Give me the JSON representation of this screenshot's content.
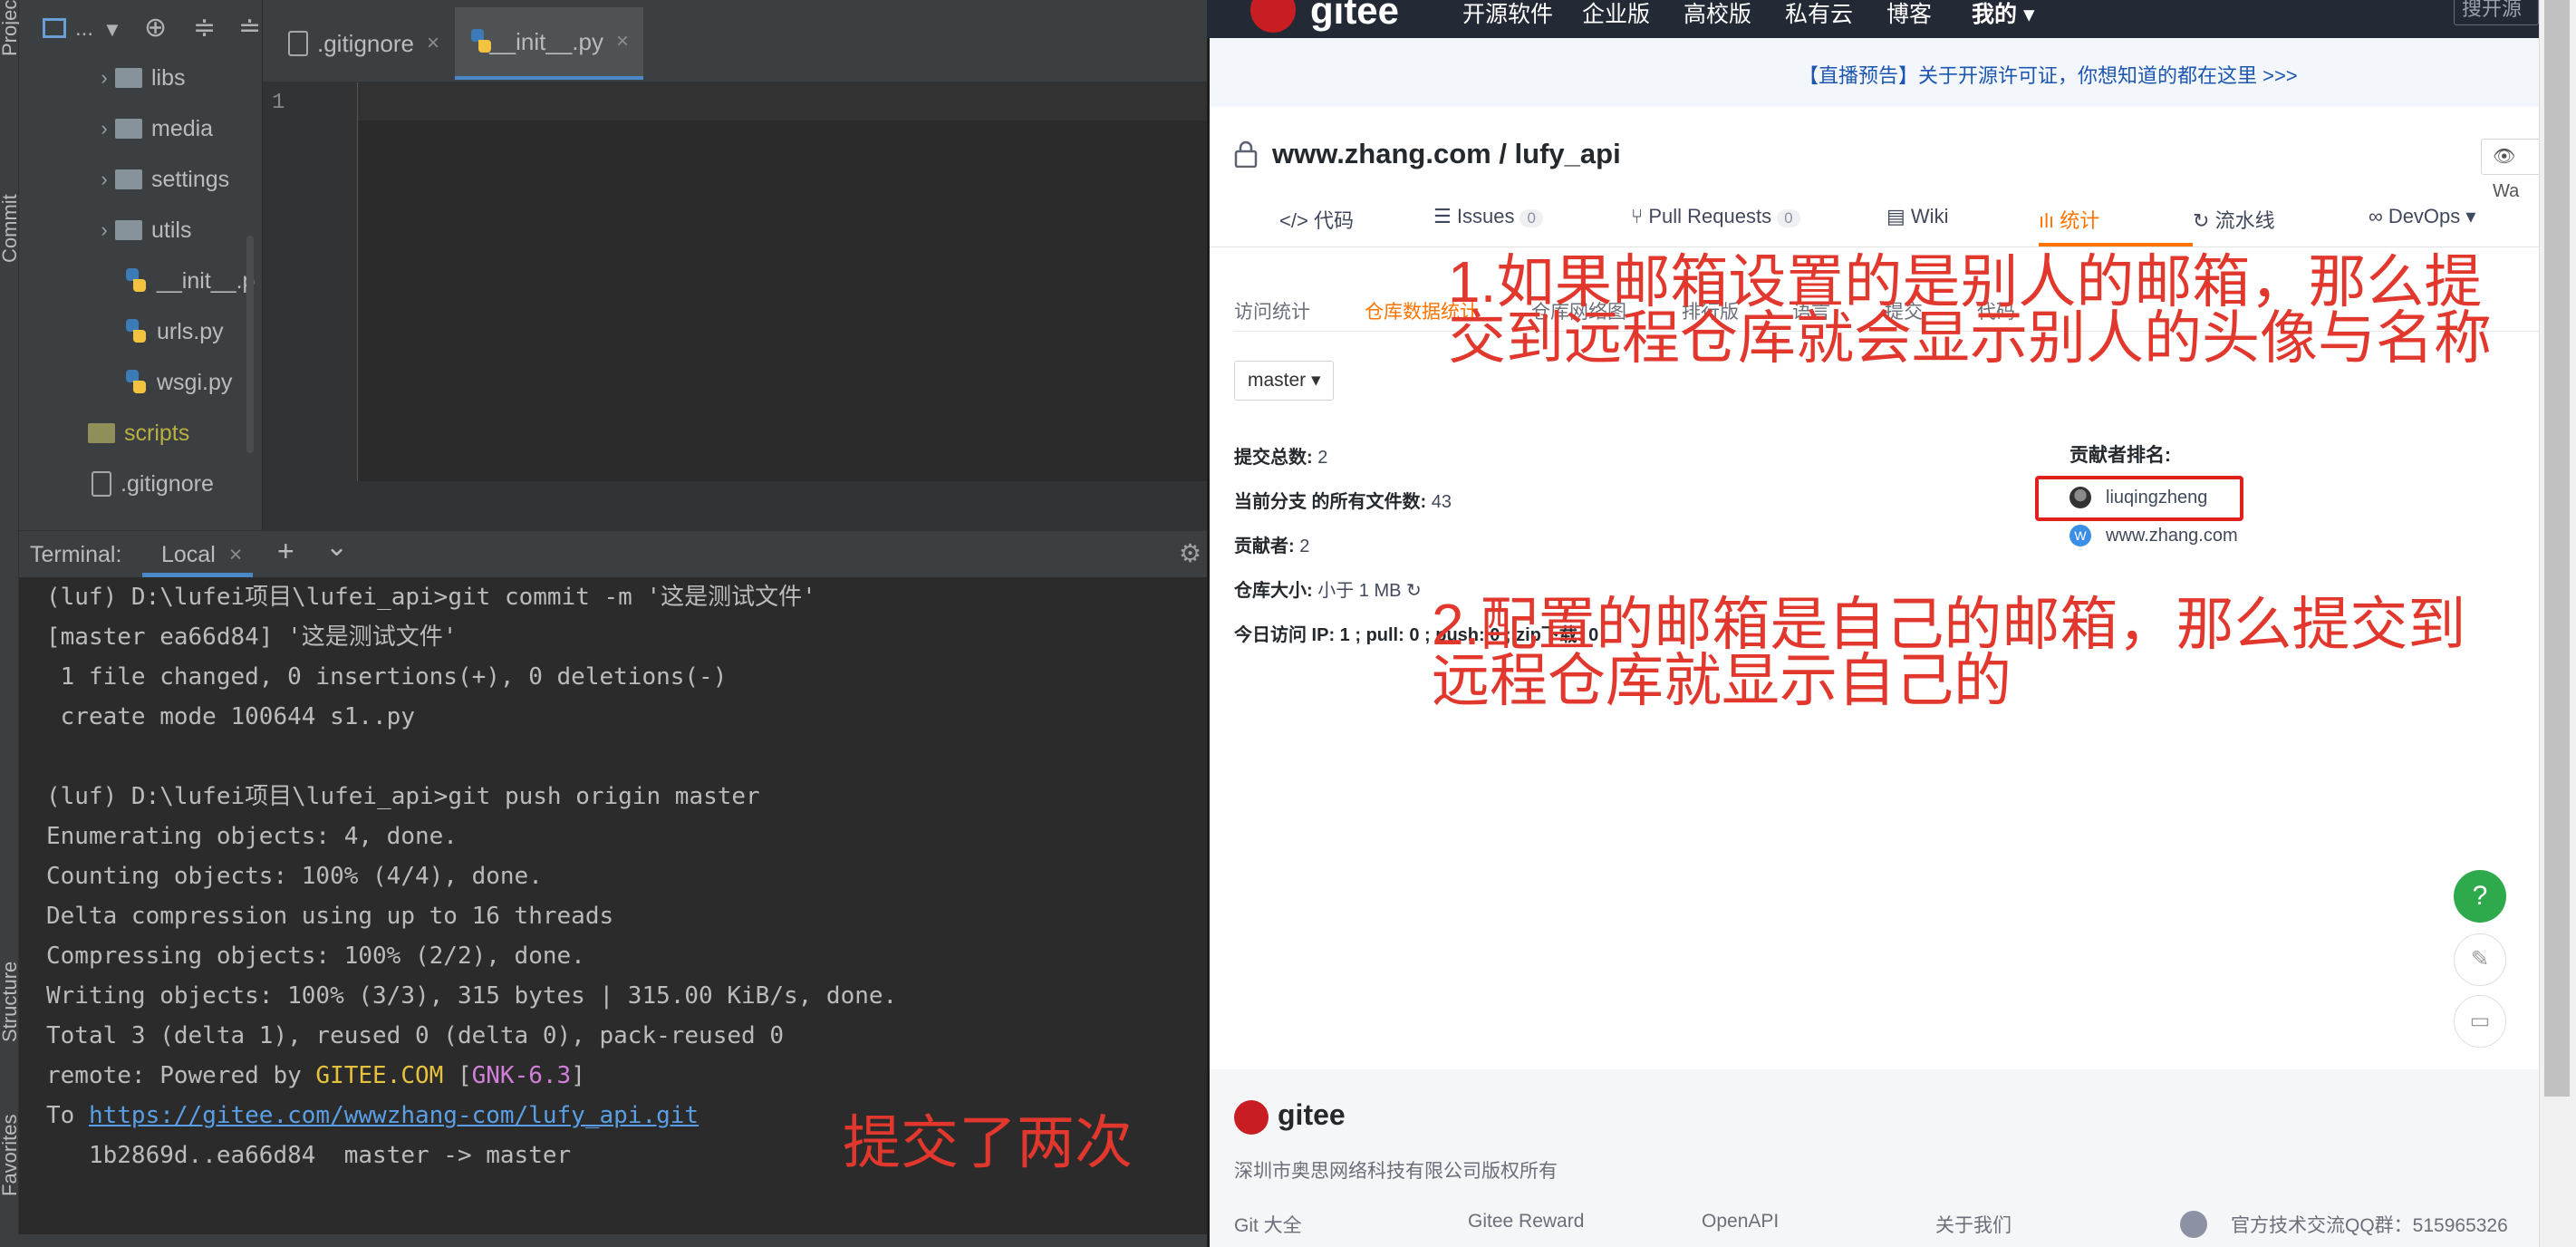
{
  "ide": {
    "side_tabs": {
      "project": "Project",
      "commit": "Commit",
      "structure": "Structure",
      "favorites": "Favorites"
    },
    "project_toolbar": {
      "dropdown": "..."
    },
    "tree": [
      {
        "label": "libs",
        "kind": "folder"
      },
      {
        "label": "media",
        "kind": "folder"
      },
      {
        "label": "settings",
        "kind": "folder"
      },
      {
        "label": "utils",
        "kind": "folder"
      },
      {
        "label": "__init__.p",
        "kind": "python-file"
      },
      {
        "label": "urls.py",
        "kind": "python-file"
      },
      {
        "label": "wsgi.py",
        "kind": "python-file"
      },
      {
        "label": "scripts",
        "kind": "folder"
      },
      {
        "label": ".gitignore",
        "kind": "git-file"
      }
    ],
    "editor_tabs": [
      {
        "label": ".gitignore",
        "close": "×"
      },
      {
        "label": "__init__.py",
        "close": "×"
      }
    ],
    "line_number": "1",
    "terminal": {
      "label": "Terminal:",
      "tab": "Local",
      "tab_close": "×",
      "add": "+",
      "menu": "⌄",
      "lines": [
        "(luf) D:\\lufei项目\\lufei_api>git commit -m '这是测试文件'",
        "[master ea66d84] '这是测试文件'",
        " 1 file changed, 0 insertions(+), 0 deletions(-)",
        " create mode 100644 s1..py",
        "",
        "(luf) D:\\lufei项目\\lufei_api>git push origin master",
        "Enumerating objects: 4, done.",
        "Counting objects: 100% (4/4), done.",
        "Delta compression using up to 16 threads",
        "Compressing objects: 100% (2/2), done.",
        "Writing objects: 100% (3/3), 315 bytes | 315.00 KiB/s, done.",
        "Total 3 (delta 1), reused 0 (delta 0), pack-reused 0"
      ],
      "remote_line": {
        "prefix": "remote: Powered by ",
        "gitee": "GITEE.COM",
        "open": " [",
        "gnk": "GNK-6.3",
        "close": "]"
      },
      "to_line": {
        "prefix": "To ",
        "url": "https://gitee.com/wwwzhang-com/lufy_api.git"
      },
      "last_line": "   1b2869d..ea66d84  master -> master"
    },
    "annotation": "提交了两次"
  },
  "browser": {
    "topnav": {
      "logo": "gitee",
      "items": [
        "开源软件",
        "企业版",
        "高校版",
        "私有云",
        "博客",
        "我的 ▾"
      ],
      "search": "搜开源"
    },
    "announcement": "【直播预告】关于开源许可证，你想知道的都在这里 >>>",
    "repo_title": "www.zhang.com / lufy_api",
    "watch": "Wa",
    "tabs": [
      {
        "label": "代码",
        "icon": "</>"
      },
      {
        "label": "Issues",
        "icon": "☰",
        "count": "0"
      },
      {
        "label": "Pull Requests",
        "icon": "⑂",
        "count": "0"
      },
      {
        "label": "Wiki",
        "icon": "▤"
      },
      {
        "label": "统计",
        "icon": "ılı"
      },
      {
        "label": "流水线",
        "icon": "↻"
      },
      {
        "label": "DevOps ▾",
        "icon": "∞"
      }
    ],
    "subtabs": [
      "访问统计",
      "仓库数据统计",
      "仓库网络图",
      "排行版",
      "语言",
      "提交",
      "代码"
    ],
    "branch": "master ▾",
    "stats": [
      {
        "label": "提交总数:",
        "value": " 2"
      },
      {
        "label": "当前分支 的所有文件数:",
        "value": " 43"
      },
      {
        "label": "贡献者:",
        "value": " 2"
      },
      {
        "label": "仓库大小:",
        "value": " 小于 1 MB ↻"
      },
      {
        "label": "今日访问 IP: 1 ; pull: 0 ; push: 0 ; zip下载: 0",
        "value": ""
      }
    ],
    "contributors_title": "贡献者排名:",
    "contributors": [
      {
        "name": "liuqingzheng",
        "avatar": "photo-avatar"
      },
      {
        "name": "www.zhang.com",
        "avatar": "W"
      }
    ],
    "annotation_1": "1.如果邮箱设置的是别人的邮箱，那么提交到远程仓库就会显示别人的头像与名称",
    "annotation_2": "2.配置的邮箱是自己的邮箱，那么提交到远程仓库就显示自己的",
    "float_buttons": {
      "help": "?",
      "edit": "✎",
      "chat": "▭"
    },
    "footer": {
      "logo": "gitee",
      "copyright": "深圳市奥思网络科技有限公司版权所有",
      "links": [
        "Git 大全",
        "Gitee Reward",
        "OpenAPI",
        "关于我们"
      ],
      "qq": "官方技术交流QQ群：515965326"
    },
    "colors": {
      "accent": "#ff7300",
      "annotation": "#e1372d",
      "brand": "#c71d23"
    }
  }
}
